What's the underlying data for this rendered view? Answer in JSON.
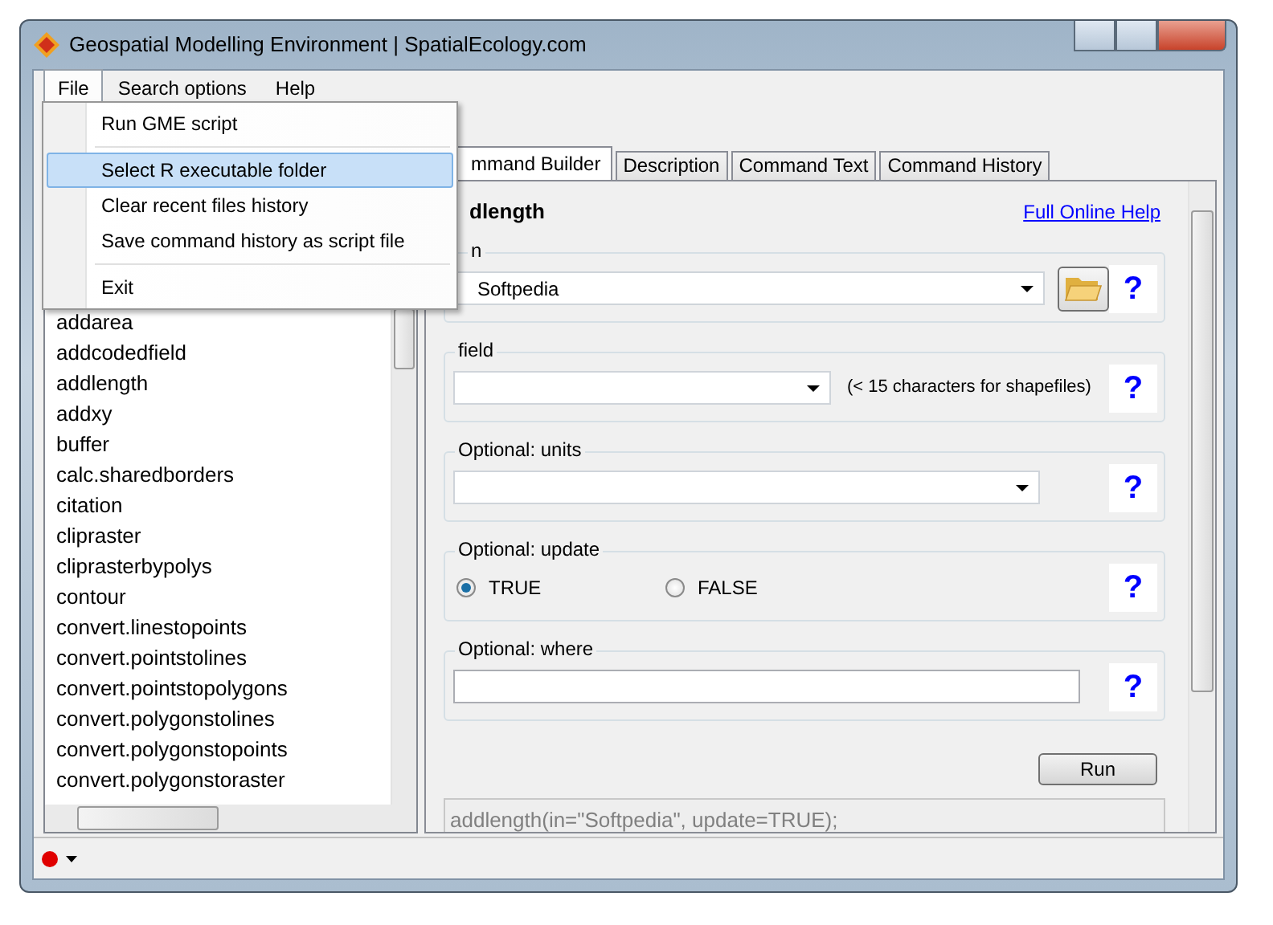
{
  "window": {
    "title": "Geospatial Modelling Environment | SpatialEcology.com"
  },
  "menu_bar": [
    {
      "label": "File",
      "selected": true
    },
    {
      "label": "Search options",
      "selected": false
    },
    {
      "label": "Help",
      "selected": false
    }
  ],
  "file_menu": [
    {
      "kind": "item",
      "label": "Run GME script",
      "selected": false
    },
    {
      "kind": "separator"
    },
    {
      "kind": "item",
      "label": "Select R executable folder",
      "selected": true
    },
    {
      "kind": "item",
      "label": "Clear recent files history",
      "selected": false
    },
    {
      "kind": "item",
      "label": "Save command history as script file",
      "selected": false
    },
    {
      "kind": "separator"
    },
    {
      "kind": "item",
      "label": "Exit",
      "selected": false
    }
  ],
  "command_list": [
    "addarea",
    "addcodedfield",
    "addlength",
    "addxy",
    "buffer",
    "calc.sharedborders",
    "citation",
    "clipraster",
    "cliprasterbypolys",
    "contour",
    "convert.linestopoints",
    "convert.pointstolines",
    "convert.pointstopolygons",
    "convert.polygonstolines",
    "convert.polygonstopoints",
    "convert.polygonstoraster"
  ],
  "tabs": [
    {
      "label": "mmand Builder",
      "selected": true
    },
    {
      "label": "Description",
      "selected": false
    },
    {
      "label": "Command Text",
      "selected": false
    },
    {
      "label": "Command History",
      "selected": false
    }
  ],
  "command": {
    "title": "dlength",
    "help_link": "Full Online Help"
  },
  "parameters": [
    {
      "kind": "file",
      "label": "n",
      "value": "Softpedia",
      "help": "?"
    },
    {
      "kind": "combo",
      "label": "field",
      "note": "(< 15 characters for shapefiles)",
      "help": "?"
    },
    {
      "kind": "combo",
      "label": "Optional: units",
      "help": "?"
    },
    {
      "kind": "radio",
      "label": "Optional: update",
      "options": [
        {
          "label": "TRUE",
          "selected": true
        },
        {
          "label": "FALSE",
          "selected": false
        }
      ],
      "help": "?"
    },
    {
      "kind": "text",
      "label": "Optional: where",
      "help": "?"
    }
  ],
  "run_button": "Run",
  "output": "addlength(in=\"Softpedia\", update=TRUE);"
}
